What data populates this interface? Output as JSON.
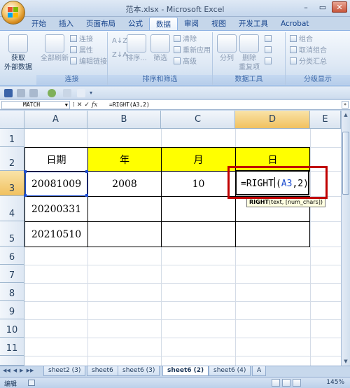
{
  "window": {
    "title": "范本.xlsx - Microsoft Excel",
    "minimize": "–",
    "restore": "▭",
    "close": "✕"
  },
  "tabs": [
    "开始",
    "插入",
    "页面布局",
    "公式",
    "数据",
    "审阅",
    "视图",
    "开发工具",
    "Acrobat"
  ],
  "active_tab": "数据",
  "ribbon": {
    "get_external_data": [
      "获取",
      "外部数据"
    ],
    "refresh_all": "全部刷新",
    "connections": "连接",
    "properties": "属性",
    "edit_links": "编辑链接",
    "group_connections": "连接",
    "sort": "排序...",
    "filter": "筛选",
    "clear": "清除",
    "reapply": "重新应用",
    "advanced": "高级",
    "group_sort_filter": "排序和筛选",
    "text_to_columns": "分列",
    "remove_duplicates": [
      "删除",
      "重复项"
    ],
    "group_data_tools": "数据工具",
    "group": "组合",
    "ungroup": "取消组合",
    "subtotal": "分类汇总",
    "group_outline": "分级显示"
  },
  "formula_bar": {
    "name_box": "MATCH",
    "formula": "=RIGHT(A3,2)"
  },
  "columns": [
    "A",
    "B",
    "C",
    "D",
    "E"
  ],
  "active_column": "D",
  "rows": [
    "1",
    "2",
    "3",
    "4",
    "5",
    "6",
    "7",
    "8",
    "9",
    "10",
    "11"
  ],
  "active_row": "3",
  "table": {
    "headers": [
      "日期",
      "年",
      "月",
      "日"
    ],
    "rows": [
      [
        "20081009",
        "2008",
        "10",
        ""
      ],
      [
        "20200331",
        "",
        "",
        ""
      ],
      [
        "20210510",
        "",
        "",
        ""
      ]
    ]
  },
  "editing": {
    "func": "=RIGHT",
    "open": "(",
    "ref": "A3",
    "rest": ",2)",
    "tooltip_func": "RIGHT",
    "tooltip_args": "(text, [num_chars])"
  },
  "sheet_tabs": [
    "sheet2 (3)",
    "sheet6",
    "sheet6 (3)",
    "sheet6 (2)",
    "sheet6 (4)",
    "A"
  ],
  "active_sheet": "sheet6 (2)",
  "status": {
    "mode": "编辑",
    "zoom": "145%"
  },
  "colors": {
    "header_fill": "#ffff00",
    "highlight_box": "#c00000",
    "ref_color": "#1f4fd1"
  }
}
